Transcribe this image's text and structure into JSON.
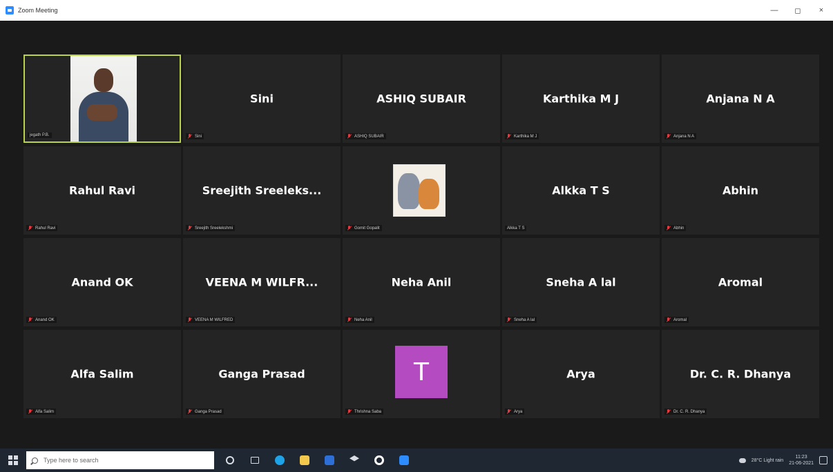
{
  "window": {
    "title": "Zoom Meeting",
    "controls": {
      "minimize": "—",
      "maximize": "◻",
      "close": "×"
    }
  },
  "participants": [
    {
      "display_name": "",
      "label": "jegath P.B.",
      "muted": false,
      "kind": "video"
    },
    {
      "display_name": "Sini",
      "label": "Sini",
      "muted": true,
      "kind": "name"
    },
    {
      "display_name": "ASHIQ SUBAIR",
      "label": "ASHIQ SUBAIR",
      "muted": true,
      "kind": "name"
    },
    {
      "display_name": "Karthika M J",
      "label": "Karthika M J",
      "muted": true,
      "kind": "name"
    },
    {
      "display_name": "Anjana N A",
      "label": "Anjana N A",
      "muted": true,
      "kind": "name"
    },
    {
      "display_name": "Rahul Ravi",
      "label": "Rahul Ravi",
      "muted": true,
      "kind": "name"
    },
    {
      "display_name": "Sreejith  Sreeleks...",
      "label": "Sreejith Sreelekshmi",
      "muted": true,
      "kind": "name"
    },
    {
      "display_name": "",
      "label": "Gomit Gopalit",
      "muted": true,
      "kind": "picture"
    },
    {
      "display_name": "Alkka T S",
      "label": "Alkka T S",
      "muted": false,
      "kind": "name"
    },
    {
      "display_name": "Abhin",
      "label": "Abhin",
      "muted": true,
      "kind": "name"
    },
    {
      "display_name": "Anand OK",
      "label": "Anand OK",
      "muted": true,
      "kind": "name"
    },
    {
      "display_name": "VEENA M WILFR...",
      "label": "VEENA M WILFRED",
      "muted": true,
      "kind": "name"
    },
    {
      "display_name": "Neha Anil",
      "label": "Neha Anil",
      "muted": true,
      "kind": "name"
    },
    {
      "display_name": "Sneha A lal",
      "label": "Sneha A lal",
      "muted": true,
      "kind": "name"
    },
    {
      "display_name": "Aromal",
      "label": "Aromal",
      "muted": true,
      "kind": "name"
    },
    {
      "display_name": "Alfa Salim",
      "label": "Alfa Salim",
      "muted": true,
      "kind": "name"
    },
    {
      "display_name": "Ganga Prasad",
      "label": "Ganga Prasad",
      "muted": true,
      "kind": "name"
    },
    {
      "display_name": "T",
      "label": "Thrishna Saba",
      "muted": true,
      "kind": "avatar"
    },
    {
      "display_name": "Arya",
      "label": "Arya",
      "muted": true,
      "kind": "name"
    },
    {
      "display_name": "Dr. C. R. Dhanya",
      "label": "Dr. C. R. Dhanya",
      "muted": true,
      "kind": "name"
    }
  ],
  "taskbar": {
    "search_placeholder": "Type here to search",
    "weather": "28°C  Light rain",
    "time": "11:23",
    "date": "21-06-2021"
  },
  "colors": {
    "active_speaker_border": "#b9d44a",
    "tile_bg": "#242424",
    "avatar_bg": "#b44bc0",
    "mute_red": "#e5393e"
  }
}
